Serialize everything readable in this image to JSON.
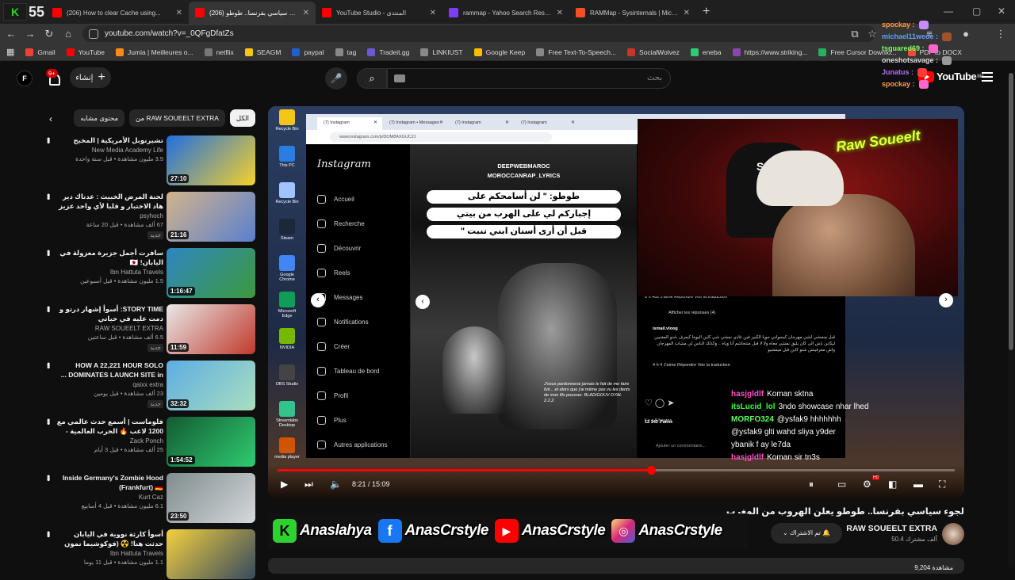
{
  "browser": {
    "tab_counter": "55",
    "tabs": [
      {
        "label": "(206) How to clear Cache using...",
        "color": "#ff0000",
        "active": false
      },
      {
        "label": "(206) لجوء سياسي بفرنسا.. طوطو...",
        "color": "#ff0000",
        "active": true
      },
      {
        "label": "YouTube Studio - المنتدى",
        "color": "#ff0000",
        "active": false
      },
      {
        "label": "rammap - Yahoo Search Results",
        "color": "#7b3ff2",
        "active": false
      },
      {
        "label": "RAMMap - Sysinternals | Micros...",
        "color": "#f25022",
        "active": false
      }
    ],
    "new_tab": "+",
    "url": "youtube.com/watch?v=_0QFgDfatZs",
    "bookmarks": [
      {
        "label": "Gmail",
        "color": "#ea4335"
      },
      {
        "label": "YouTube",
        "color": "#ff0000"
      },
      {
        "label": "Jumia | Meilleures o...",
        "color": "#f68b1e"
      },
      {
        "label": "netflix",
        "color": "#777777"
      },
      {
        "label": "SEAGM",
        "color": "#f5c518"
      },
      {
        "label": "paypal",
        "color": "#1e63c4"
      },
      {
        "label": "tag",
        "color": "#888888"
      },
      {
        "label": "Tradeit.gg",
        "color": "#6a5acd"
      },
      {
        "label": "LINKIUST",
        "color": "#888888"
      },
      {
        "label": "Google Keep",
        "color": "#fbbc04"
      },
      {
        "label": "Free Text-To-Speech...",
        "color": "#888888"
      },
      {
        "label": "SocialWolvez",
        "color": "#c0392b"
      },
      {
        "label": "eneba",
        "color": "#2ecc71"
      },
      {
        "label": "https://www.striking...",
        "color": "#8e44ad"
      },
      {
        "label": "Free Cursor Downlo...",
        "color": "#27ae60"
      },
      {
        "label": "PDF to DOCX",
        "color": "#e74c3c"
      }
    ]
  },
  "overlay_chat_top": [
    {
      "user": "spockay :",
      "color": "#ff9d3b"
    },
    {
      "user": "michael11wede :",
      "color": "#5f9cff"
    },
    {
      "user": "tsquared69 :",
      "color": "#7cff5a"
    },
    {
      "user": "oneshotsavage :",
      "color": "#dcdcdc"
    },
    {
      "user": "Junatus :",
      "color": "#b46cff"
    },
    {
      "user": "spockay :",
      "color": "#ff9d3b"
    }
  ],
  "header": {
    "avatar_letter": "F",
    "notif_count": "9+",
    "create_label": "إنشاء",
    "search_placeholder": "بحث",
    "logo_text": "YouTube",
    "logo_region": "MA"
  },
  "chips": [
    "الكل",
    "من RAW SOUEELT EXTRA",
    "محتوى مشابه"
  ],
  "recommendations": [
    {
      "title": "تشيرنوبل الأمريكية | المخبح",
      "channel": "New Media Academy Life",
      "meta": "3.5 مليون مشاهدة • قبل سنة واحدة",
      "duration": "27:10",
      "new": "",
      "thumb": "linear-gradient(135deg,#1f6fe0,#f6d12b)"
    },
    {
      "title": "لحنة المرض الخبيث : عدناك دير هاد الاختبار و قلبا لأي واحد عزيز عليك | ...",
      "channel": "psyhoch",
      "meta": "67 ألف مشاهدة • قبل 20 ساعة",
      "duration": "21:16",
      "new": "جديد",
      "thumb": "linear-gradient(135deg,#d2b48c,#5a7fcf)"
    },
    {
      "title": "سافرت أجمل جزيرة معزولة في اليابان! 🇯🇵",
      "channel": "Ibn Hattuta Travels",
      "meta": "1.5 مليون مشاهدة • قبل أسبوعين",
      "duration": "1:16:47",
      "new": "",
      "thumb": "linear-gradient(135deg,#2e86c1,#3c9a3c)"
    },
    {
      "title": "STORY TIME: أسوأ إشهار درتو و دمت عليه في حياتي",
      "channel": "RAW SOUEELT EXTRA",
      "meta": "6.5 ألف مشاهدة • قبل ساعتين",
      "duration": "11:59",
      "new": "جديد",
      "thumb": "linear-gradient(135deg,#e8e8e8,#c0392b)"
    },
    {
      "title": "HOW A 22,221 HOUR SOLO DOMINATES LAUNCH SITE in ...",
      "channel": "qaixx extra",
      "meta": "23 ألف مشاهدة • قبل يومين",
      "duration": "32:32",
      "new": "جديد",
      "thumb": "linear-gradient(135deg,#5dade2,#a9dfbf)"
    },
    {
      "title": "فلوماست | أسمع حدث عالمي مع 1200 لاعب 🔥 الحرب العالمية - Rust ...",
      "channel": "Zack Ponch",
      "meta": "25 ألف مشاهدة • قبل 3 أيام",
      "duration": "1:54:52",
      "new": "",
      "thumb": "linear-gradient(135deg,#145a32,#2ecc71)"
    },
    {
      "title": "Inside Germany's Zombie Hood (Frankfurt) 🇩🇪",
      "channel": "Kurt Caz",
      "meta": "6.1 مليون مشاهدة • قبل 4 أسابيع",
      "duration": "23:50",
      "new": "",
      "thumb": "linear-gradient(135deg,#7f8c8d,#d5d8dc)"
    },
    {
      "title": "أسوأ كارثة نووية في اليابان حدثت هنا! ☢️ (فوكوشيما تمون بالي)",
      "channel": "Ibn Hattuta Travels",
      "meta": "1.1 مليون مشاهدة • قبل 11 يوما",
      "duration": "",
      "new": "",
      "thumb": "linear-gradient(135deg,#f4d03f,#34495e)"
    }
  ],
  "player": {
    "time": "8:21 / 15:09",
    "progress": 0.551,
    "desktop_icons": [
      "Recycle Bin",
      "This PC",
      "Recycle Bin",
      "Steam",
      "Google Chrome",
      "Microsoft Edge",
      "NVIDIA",
      "OBS Studio",
      "Streamlabs Desktop",
      "media player"
    ],
    "ig": {
      "tabs": [
        "(7) Instagram",
        "(7) Instagram • Messages",
        "(7) Instagram",
        "(7) Instagram"
      ],
      "url": "www.instagram.com/p/DOM8AXGUC2J",
      "brand": "Instagram",
      "nav": [
        "Accueil",
        "Recherche",
        "Découvrir",
        "Reels",
        "Messages",
        "Notifications",
        "Créer",
        "Tableau de bord",
        "Profil",
        "Plus",
        "Autres applications"
      ],
      "post_source_1": "DEEPWEBMAROC",
      "post_source_2": "MOROCCANRAP_LYRICS",
      "quote_1": "طوطو: \" لن أسامحكم على",
      "quote_2": "إجباركم لي على الهرب من بيتي",
      "quote_3": "قبل أن أرى أسنان ابني تنبت \"",
      "post_french": "J'vous pardonnerai jamais le fait de me faire fuir... et alors que j'ai même pas vu les dents de mon fils pousser. BLAD/GOUV DYAL 2.2.2.",
      "comment_meta": "8 h  482 J'aime  Répondre  Voir la traduction",
      "see_replies": "Afficher les réponses (4)",
      "comment_user": "ismail.vloog",
      "comment_text": "قبل منمشي لشي مهرجان كيسولني حويا الكبير فين غادي نمشي شي كاين اليوما كيعرف شنو المغنيين ليكاين باش الى كان يليق نمشي معاه ولا لا قبل متتحاشم أنا وياه .. وكذلك الناس لي مشات المهرجان واش معرفينش شنو كاين قبل ميمشيو",
      "comment_meta2": "4 h  4 J'aime  Répondre  Voir la traduction",
      "reply_meta": "il y a 9 heures",
      "likes": "12 143 J'aime",
      "add_comment": "Ajouter un commentaire..."
    },
    "neon_text": "Raw Soueelt",
    "chair_logo": "SG",
    "twitch_chat": [
      {
        "user": "hasjgldlf",
        "msg": "Koman sktna",
        "color": "#ff4ec7"
      },
      {
        "user": "itsLucid_lol",
        "msg": "3ndo showcase nhar lhed",
        "color": "#3cff3c"
      },
      {
        "user": "MORFO324",
        "msg": "@ysfak9 hhhhhhh",
        "color": "#5dff5d"
      },
      {
        "user": "",
        "msg": "@ysfak9 glti wahd sliya y9der",
        "color": "#ffffff"
      },
      {
        "user": "",
        "msg": "ybanik f ay le7da",
        "color": "#ffffff"
      },
      {
        "user": "hasjgldlf",
        "msg": "Koman sir tn3s",
        "color": "#ff4ec7"
      }
    ]
  },
  "video": {
    "title": "لجوء سياسي بفرنسا.. طوطو يعلن الهروب من المغرب",
    "channel": "RAW SOUEELT EXTRA",
    "subs": "50.4 ألف مشترك",
    "subscribed_label": "تم الاشتراك",
    "banner": [
      "Anaslahya",
      "AnasCrstyle",
      "AnasCrstyle",
      "AnasCrstyle"
    ],
    "desc_preview": "9,204 مشاهدة"
  }
}
